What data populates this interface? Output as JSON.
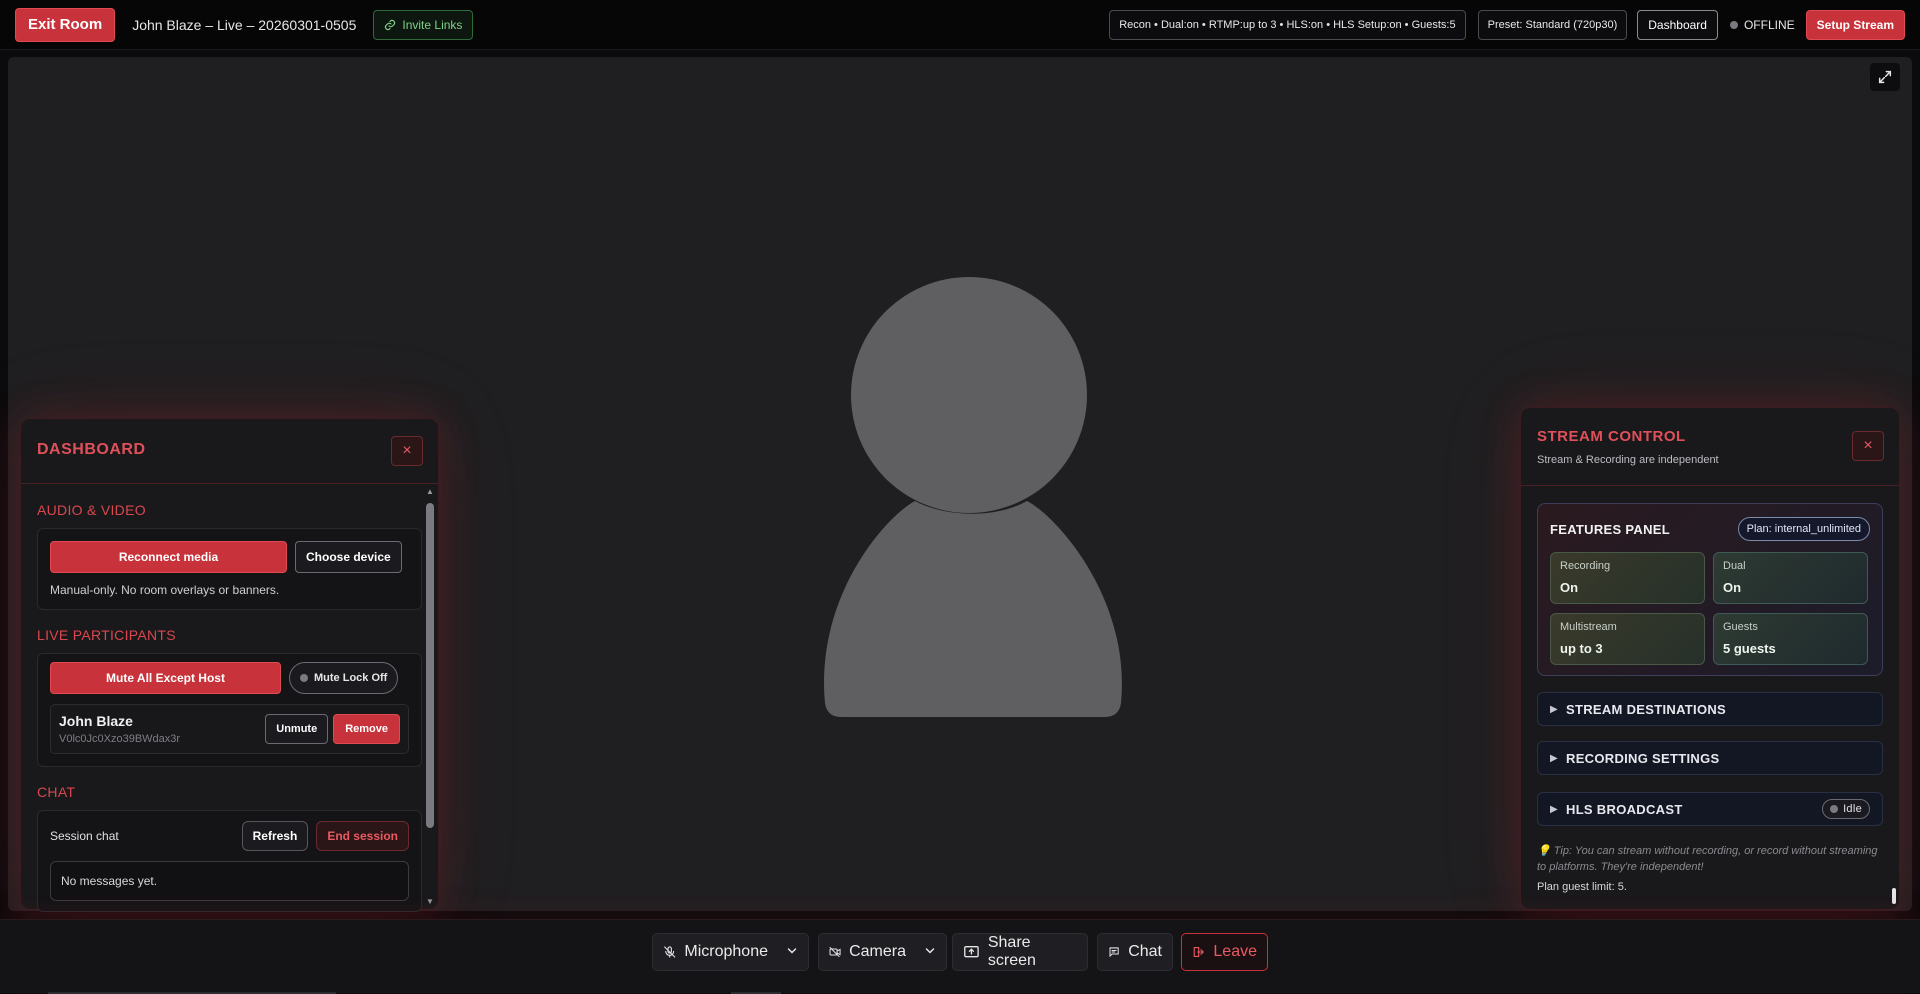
{
  "topbar": {
    "exit_label": "Exit Room",
    "room_title": "John Blaze – Live – 20260301-0505",
    "invite_label": "Invite Links",
    "features_summary": "Recon • Dual:on • RTMP:up to 3 • HLS:on • HLS Setup:on • Guests:5",
    "preset": "Preset: Standard (720p30)",
    "dashboard_label": "Dashboard",
    "status": "OFFLINE",
    "setup_label": "Setup Stream"
  },
  "dashboard": {
    "title": "DASHBOARD",
    "close": "×",
    "av_section": "AUDIO & VIDEO",
    "reconnect_label": "Reconnect media",
    "choose_label": "Choose device",
    "av_hint": "Manual-only. No room overlays or banners.",
    "participants_section": "LIVE PARTICIPANTS",
    "mute_all_label": "Mute All Except Host",
    "mute_lock_label": "Mute Lock Off",
    "participant": {
      "name": "John Blaze",
      "id": "V0lc0Jc0Xzo39BWdax3r",
      "unmute_label": "Unmute",
      "remove_label": "Remove"
    },
    "chat_section": "CHAT",
    "chat_label": "Session chat",
    "refresh_label": "Refresh",
    "end_session_label": "End session",
    "no_messages": "No messages yet."
  },
  "stream_control": {
    "title": "STREAM CONTROL",
    "subtitle": "Stream & Recording are independent",
    "close": "×",
    "features_title": "FEATURES PANEL",
    "plan": "Plan: internal_unlimited",
    "features": [
      {
        "key": "Recording",
        "value": "On"
      },
      {
        "key": "Dual",
        "value": "On"
      },
      {
        "key": "Multistream",
        "value": "up to 3"
      },
      {
        "key": "Guests",
        "value": "5 guests"
      }
    ],
    "sections": [
      {
        "label": "STREAM DESTINATIONS"
      },
      {
        "label": "RECORDING SETTINGS"
      },
      {
        "label": "HLS BROADCAST",
        "status": "Idle"
      }
    ],
    "tip": "💡 Tip: You can stream without recording, or record without streaming to platforms. They're independent!",
    "guest_limit": "Plan guest limit: 5."
  },
  "controls": {
    "microphone": "Microphone",
    "camera": "Camera",
    "share": "Share screen",
    "chat": "Chat",
    "leave": "Leave"
  },
  "colors": {
    "accent_red": "#c8323a",
    "panel_bg": "#19191b",
    "stage_bg": "#1f1f21",
    "avatar": "#5f5f61",
    "invite_green": "#7fd28a"
  }
}
